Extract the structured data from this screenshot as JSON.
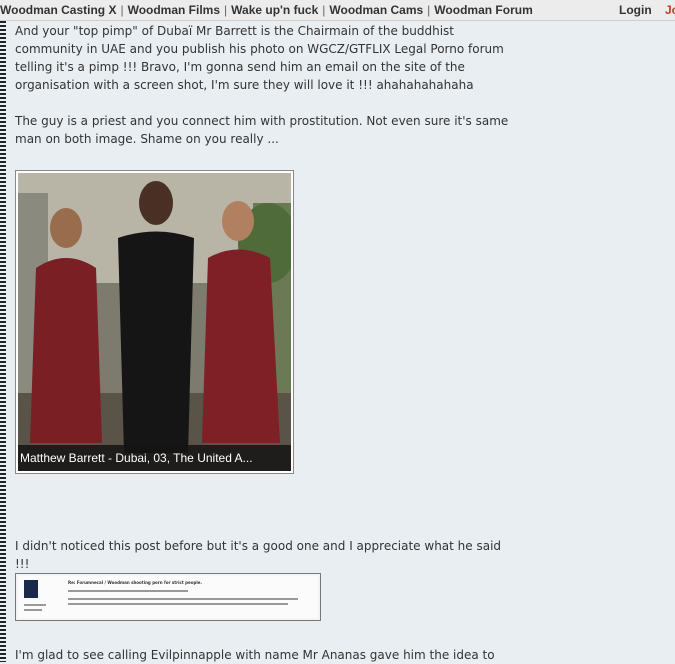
{
  "topbar": {
    "nav": [
      "Woodman Casting X",
      "Woodman Films",
      "Wake up'n fuck",
      "Woodman Cams",
      "Woodman Forum"
    ],
    "separator": "|",
    "login": "Login",
    "join": "Jo"
  },
  "post": {
    "paragraph1": "And your \"top pimp\" of Dubaï Mr Barrett is the Chairmain of the buddhist community in UAE and you publish his photo on WGCZ/GTFLIX Legal Porno forum telling it's a pimp !!! Bravo, I'm gonna send him an email on the site of the organisation with a screen shot, I'm sure they will love it !!! ahahahahahaha",
    "paragraph2": "The guy is a priest and you connect him with prostitution. Not even sure it's same man on both image. Shame on you really ...",
    "photo_caption": "Matthew Barrett - Dubai, 03, The United A...",
    "paragraph3": "I didn't noticed this post before but it's a good one and I appreciate what he said !!!",
    "thumb_title": "Re: Forumnecal / Woodman shooting porn for strict people.",
    "paragraph4": "I'm glad to see calling Evilpinnapple with name Mr Ananas gave him the idea to"
  },
  "colors": {
    "background": "#e9eef2",
    "text": "#333333",
    "join": "#c0392b"
  }
}
